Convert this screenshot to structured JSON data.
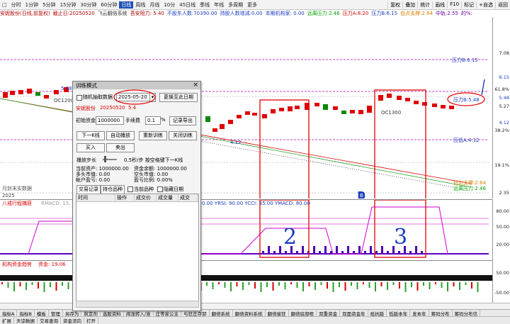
{
  "toolbar": {
    "items": [
      "分时",
      "1分钟",
      "5分钟",
      "15分钟",
      "30分钟",
      "60分钟",
      "日线",
      "周线",
      "月线",
      "10分",
      "45日线",
      "季线",
      "年线",
      "多周期",
      "更多"
    ],
    "selected_index": 6,
    "right_items": [
      "复权",
      "叠加",
      "统计",
      "画线",
      "F10",
      "标记",
      "+自选",
      "返回"
    ]
  },
  "infoline": {
    "title": "安妮股份(日线,前复权)",
    "date": "截止日:20250520",
    "system": "飞云翻倍系统",
    "resist": "吾安阻力: 5.40",
    "holders": "不股东人数:70390.00",
    "share_change": "持股人数增减:0.00",
    "inst": "本期机构家: 0.00",
    "far": "远离压力:2.46",
    "pa": "压力A:8.20",
    "pb": "压力B:6.15",
    "support": "低点支撑:2.64",
    "mid": "中轨:2.55",
    "pct": "的%:"
  },
  "chart_labels": {
    "press_b_top": "压力B:6.15",
    "press_b_right": "压力B:5.48",
    "value_4_12": "4.12",
    "press_low": "压低A:4.12",
    "support_low": "低点支撑:2.64",
    "far_press": "远离压力:2.46",
    "left_price": "5.98",
    "oc_left": "OC1200",
    "oc_right": "OC1300",
    "bottom_left_note": "月封末实数据",
    "date_left": "2025",
    "annot_2": "2",
    "annot_3": "3",
    "marker_b": "B"
  },
  "yaxis": {
    "ticks": [
      "7.08",
      "6.15",
      "61.8%",
      "5.48",
      "5.27",
      "4.12",
      "38.2%",
      "19.1%",
      "2.35"
    ],
    "panel1": [
      "80.00",
      "50.00",
      "20.00"
    ],
    "panel2": [
      "50.00",
      "",
      "-50.00"
    ]
  },
  "panel1": {
    "title": "八戒行程捕获",
    "text": "RMACD: 15.",
    "right_text": "0.00 YRSI: 90.00 YCCI: 35.00 YMACD: 80.00"
  },
  "panel2": {
    "title": "机构资金趋势",
    "text": "资金: 19.06"
  },
  "bottom_tabs_1": [
    "指标A",
    "指标B",
    "模板",
    "管理",
    "另存为",
    "筑定剂",
    "选股资料",
    "闻涨转入/准",
    "庄等家公主",
    "与狂庄存卸",
    "翻倍系统",
    "翻倍资料系统",
    "翻倍拔狂",
    "翻倍底部框",
    "双重资金",
    "双面资金年",
    "抵抗版",
    "低版本年",
    "发本年",
    "筹码分布",
    "筹码分布信"
  ],
  "bottom_tabs_2": [
    "扩展",
    "天谅数据",
    "交易查询",
    "资金流向",
    "打开"
  ],
  "dialog": {
    "title": "训练模式",
    "random_label": "随机抽取数据",
    "date_value": "2025-05-20",
    "refresh_button": "更换至此日期",
    "stock_name": "安妮股份",
    "stock_date": "20250520",
    "stock_change": "5.4",
    "init_funds_label": "初始资金",
    "init_funds_value": "1000000",
    "fee_label": "手续费",
    "fee_value": "0.1",
    "fee_unit": "%",
    "export_button": "记录导出",
    "next_kline": "下一K线",
    "auto_play": "自动播放",
    "restart": "重新训练",
    "close": "关闭训练",
    "buy": "买入",
    "sell": "卖出",
    "step_label": "播放步长",
    "step_value": "0.5秒/步 按空格键下一K线",
    "assets_label": "当前资产: 1000000.00",
    "funds_left": "资金余额: 1000000.00",
    "long_mv": "多头市值: 0.00",
    "short_mv": "空头市值: 0.00",
    "account_pl": "帐户盈亏: 0.00",
    "pl_ratio": "盈亏比例: 0.00%",
    "tab_trades": "交易记录",
    "tab_positions": "持仓品种",
    "current_label": "当前品种",
    "hide_date_label": "隐藏日期",
    "columns": [
      "时间",
      "操作",
      "成交价",
      "成交量",
      "成交"
    ]
  }
}
